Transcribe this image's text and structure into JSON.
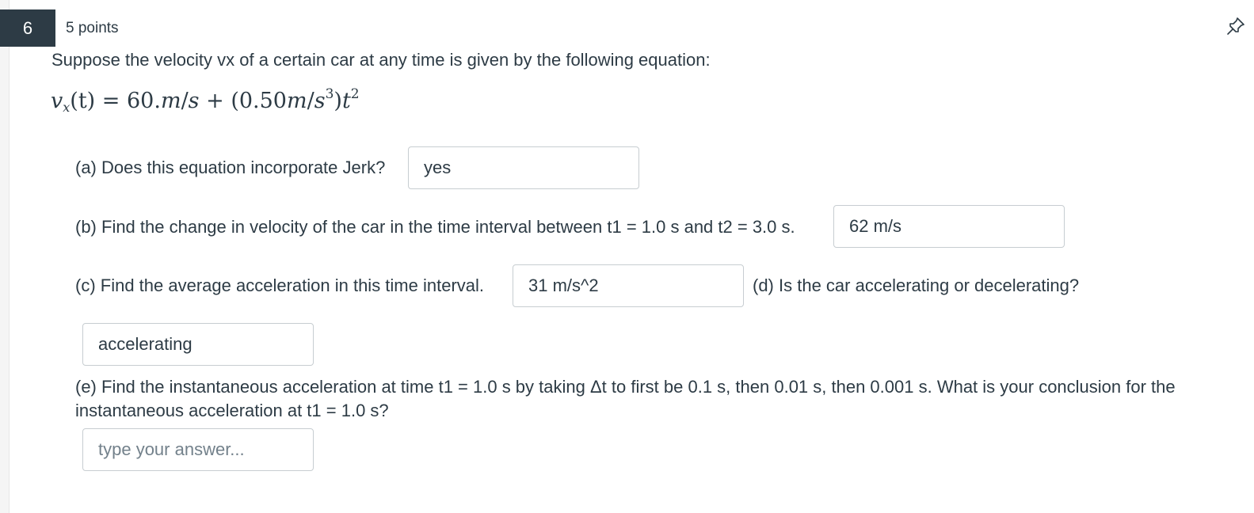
{
  "question": {
    "number": "6",
    "points": "5 points",
    "stem": "Suppose the velocity vx of a certain car at any time is given by the following equation:",
    "equation": {
      "v": "v",
      "sub": "x",
      "t_paren": "(t)",
      "eq": " = 60.",
      "m1": "m",
      "slash1": "/",
      "s1": "s",
      "plus": " + (0.50",
      "m2": "m",
      "slash2": "/",
      "s2": "s",
      "exp3": "3",
      "close": ")",
      "t2": "t",
      "exp2": "2"
    },
    "parts": {
      "a": {
        "label": "(a) Does this equation incorporate Jerk?",
        "answer": "yes"
      },
      "b": {
        "label": "(b) Find the change in velocity of the car in the time interval between t1 = 1.0 s and t2 = 3.0 s.",
        "answer": "62 m/s"
      },
      "c": {
        "label": "(c) Find the average acceleration in this time interval.",
        "answer": "31 m/s^2"
      },
      "d": {
        "label": "(d) Is the car accelerating or decelerating?",
        "answer": "accelerating"
      },
      "e": {
        "label": "(e) Find the instantaneous acceleration at time t1 = 1.0 s by taking Δt to first be 0.1 s, then 0.01 s, then 0.001 s. What is your conclusion for the instantaneous acceleration at t1 = 1.0 s?",
        "answer": "",
        "placeholder": "type your answer..."
      }
    },
    "pin_icon": "pin-icon"
  }
}
